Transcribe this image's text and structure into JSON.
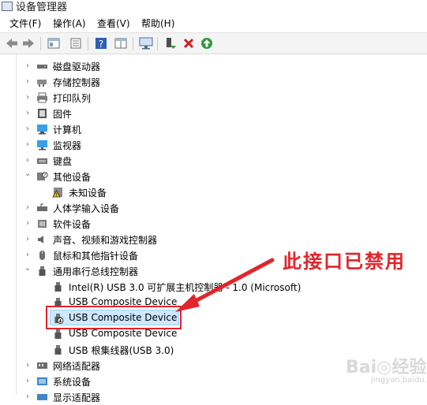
{
  "window": {
    "title": "设备管理器"
  },
  "menu": [
    {
      "label": "文件(F)"
    },
    {
      "label": "操作(A)"
    },
    {
      "label": "查看(V)"
    },
    {
      "label": "帮助(H)"
    }
  ],
  "toolbar": {
    "icons": [
      "back-arrow-icon",
      "forward-arrow-icon",
      "show-hide-tree-icon",
      "properties-icon",
      "help-icon",
      "view-icon",
      "monitor-scan-icon",
      "enable-device-icon",
      "uninstall-x-icon",
      "update-driver-icon"
    ]
  },
  "tree": [
    {
      "label": "磁盘驱动器",
      "level": 1,
      "chev": "›",
      "icon": "disk-drive-icon"
    },
    {
      "label": "存储控制器",
      "level": 1,
      "chev": "›",
      "icon": "storage-controller-icon"
    },
    {
      "label": "打印队列",
      "level": 1,
      "chev": "›",
      "icon": "printer-icon"
    },
    {
      "label": "固件",
      "level": 1,
      "chev": "›",
      "icon": "firmware-icon"
    },
    {
      "label": "计算机",
      "level": 1,
      "chev": "›",
      "icon": "computer-icon"
    },
    {
      "label": "监视器",
      "level": 1,
      "chev": "›",
      "icon": "monitor-icon"
    },
    {
      "label": "键盘",
      "level": 1,
      "chev": "›",
      "icon": "keyboard-icon"
    },
    {
      "label": "其他设备",
      "level": 1,
      "chev": "⌄",
      "icon": "other-devices-icon"
    },
    {
      "label": "未知设备",
      "level": 2,
      "chev": "",
      "icon": "unknown-device-warning-icon"
    },
    {
      "label": "人体学输入设备",
      "level": 1,
      "chev": "›",
      "icon": "hid-icon"
    },
    {
      "label": "软件设备",
      "level": 1,
      "chev": "›",
      "icon": "software-device-icon"
    },
    {
      "label": "声音、视频和游戏控制器",
      "level": 1,
      "chev": "›",
      "icon": "speaker-icon"
    },
    {
      "label": "鼠标和其他指针设备",
      "level": 1,
      "chev": "›",
      "icon": "mouse-icon"
    },
    {
      "label": "通用串行总线控制器",
      "level": 1,
      "chev": "⌄",
      "icon": "usb-icon"
    },
    {
      "label": "Intel(R) USB 3.0 可扩展主机控制器 - 1.0 (Microsoft)",
      "level": 2,
      "chev": "",
      "icon": "usb-icon"
    },
    {
      "label": "USB Composite Device",
      "level": 2,
      "chev": "",
      "icon": "usb-icon"
    },
    {
      "label": "USB Composite Device",
      "level": 2,
      "chev": "",
      "icon": "usb-disabled-icon",
      "selected": true
    },
    {
      "label": "USB Composite Device",
      "level": 2,
      "chev": "",
      "icon": "usb-icon"
    },
    {
      "label": "USB 根集线器(USB 3.0)",
      "level": 2,
      "chev": "",
      "icon": "usb-icon"
    },
    {
      "label": "网络适配器",
      "level": 1,
      "chev": "›",
      "icon": "network-adapter-icon"
    },
    {
      "label": "系统设备",
      "level": 1,
      "chev": "›",
      "icon": "system-device-icon"
    },
    {
      "label": "显示适配器",
      "level": 1,
      "chev": "›",
      "icon": "display-adapter-icon"
    }
  ],
  "annotation": {
    "callout": "此接口已禁用"
  },
  "watermark": {
    "main": "Bai◎经验",
    "sub": "jingyan.baidu.com"
  },
  "colors": {
    "accent_red": "#e3242b",
    "selection": "#cde8ff"
  }
}
